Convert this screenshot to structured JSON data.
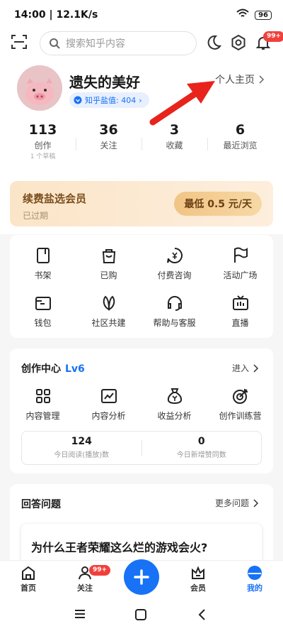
{
  "status": {
    "time": "14:00",
    "speed": "12.1K/s",
    "battery": "96"
  },
  "search": {
    "placeholder": "搜索知乎内容"
  },
  "notif_badge": "99+",
  "profile": {
    "name": "遗失的美好",
    "salt": "知乎盐值: 404",
    "homepage": "个人主页"
  },
  "stats": [
    {
      "num": "113",
      "label": "创作",
      "sub": "1 个草稿"
    },
    {
      "num": "36",
      "label": "关注",
      "sub": ""
    },
    {
      "num": "3",
      "label": "收藏",
      "sub": ""
    },
    {
      "num": "6",
      "label": "最近浏览",
      "sub": ""
    }
  ],
  "vip": {
    "title": "续费盐选会员",
    "status": "已过期",
    "button": "最低 0.5 元/天"
  },
  "services": [
    {
      "label": "书架",
      "icon": "bookshelf-icon"
    },
    {
      "label": "已购",
      "icon": "bag-icon"
    },
    {
      "label": "付费咨询",
      "icon": "consult-icon"
    },
    {
      "label": "活动广场",
      "icon": "flag-icon"
    },
    {
      "label": "钱包",
      "icon": "wallet-icon"
    },
    {
      "label": "社区共建",
      "icon": "leaf-icon"
    },
    {
      "label": "帮助与客服",
      "icon": "headset-icon"
    },
    {
      "label": "直播",
      "icon": "tv-icon"
    }
  ],
  "creator": {
    "title": "创作中心",
    "level": "Lv6",
    "enter": "进入",
    "items": [
      {
        "label": "内容管理",
        "icon": "grid-icon"
      },
      {
        "label": "内容分析",
        "icon": "chart-icon"
      },
      {
        "label": "收益分析",
        "icon": "moneybag-icon"
      },
      {
        "label": "创作训练营",
        "icon": "target-icon"
      }
    ],
    "today": [
      {
        "num": "124",
        "label": "今日阅读(播放)数"
      },
      {
        "num": "0",
        "label": "今日新增赞同数"
      }
    ]
  },
  "answers": {
    "title": "回答问题",
    "more": "更多问题",
    "question": "为什么王者荣耀这么烂的游戏会火?"
  },
  "tabs": [
    {
      "label": "首页",
      "icon": "home-icon"
    },
    {
      "label": "关注",
      "icon": "follow-icon",
      "badge": "99+"
    },
    {
      "label": "",
      "icon": "plus-icon"
    },
    {
      "label": "会员",
      "icon": "crown-icon"
    },
    {
      "label": "我的",
      "icon": "me-icon"
    }
  ],
  "colors": {
    "accent": "#1772f6",
    "badge": "#f1403c",
    "arrow": "#e8231c"
  }
}
